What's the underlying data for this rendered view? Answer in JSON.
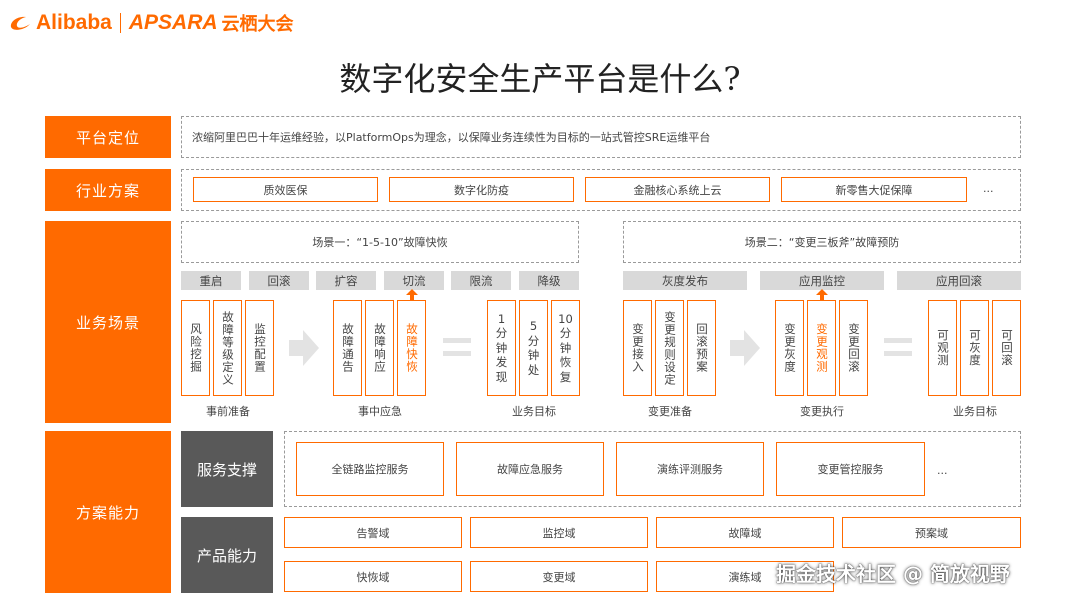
{
  "header": {
    "logo_alibaba": "Alibaba",
    "logo_apsara": "APSARA",
    "logo_yunqi": "云栖大会"
  },
  "title": "数字化安全生产平台是什么?",
  "rows": {
    "positioning": {
      "label": "平台定位",
      "text": "浓缩阿里巴巴十年运维经验，以PlatformOps为理念，以保障业务连续性为目标的一站式管控SRE运维平台"
    },
    "industry": {
      "label": "行业方案",
      "items": [
        "质效医保",
        "数字化防疫",
        "金融核心系统上云",
        "新零售大促保障"
      ],
      "more": "..."
    },
    "scenario": {
      "label": "业务场景",
      "scene1": {
        "title": "场景一：“1-5-10”故障快恢",
        "tags": [
          "重启",
          "回滚",
          "扩容",
          "切流",
          "限流",
          "降级"
        ],
        "pre": [
          "风险挖掘",
          "故障等级定义",
          "监控配置"
        ],
        "mid": [
          "故障通告",
          "故障响应",
          "故障快恢"
        ],
        "goal": [
          "1\n分\n钟\n发\n现",
          "5\n分\n钟\n处",
          "10\n分\n钟\n恢\n复"
        ],
        "captions": [
          "事前准备",
          "事中应急",
          "业务目标"
        ]
      },
      "scene2": {
        "title": "场景二：“变更三板斧”故障预防",
        "tags": [
          "灰度发布",
          "应用监控",
          "应用回滚"
        ],
        "prep": [
          "变更接入",
          "变更规则设定",
          "回滚预案"
        ],
        "exec": [
          "变更灰度",
          "变更观测",
          "变更回滚"
        ],
        "goal": [
          "可观测",
          "可灰度",
          "可回滚"
        ],
        "captions": [
          "变更准备",
          "变更执行",
          "业务目标"
        ]
      }
    },
    "capability": {
      "label": "方案能力",
      "service": {
        "label": "服务支撑",
        "items": [
          "全链路监控服务",
          "故障应急服务",
          "演练评测服务",
          "变更管控服务"
        ],
        "more": "..."
      },
      "product": {
        "label": "产品能力",
        "items": [
          "告警域",
          "监控域",
          "故障域",
          "预案域",
          "快恢域",
          "变更域",
          "演练域"
        ]
      }
    }
  },
  "watermark": "掘金技术社区 @ 简放视野",
  "colors": {
    "accent": "#ff6a00",
    "dark_label": "#595959",
    "tag_gray": "#d9d9d9"
  }
}
